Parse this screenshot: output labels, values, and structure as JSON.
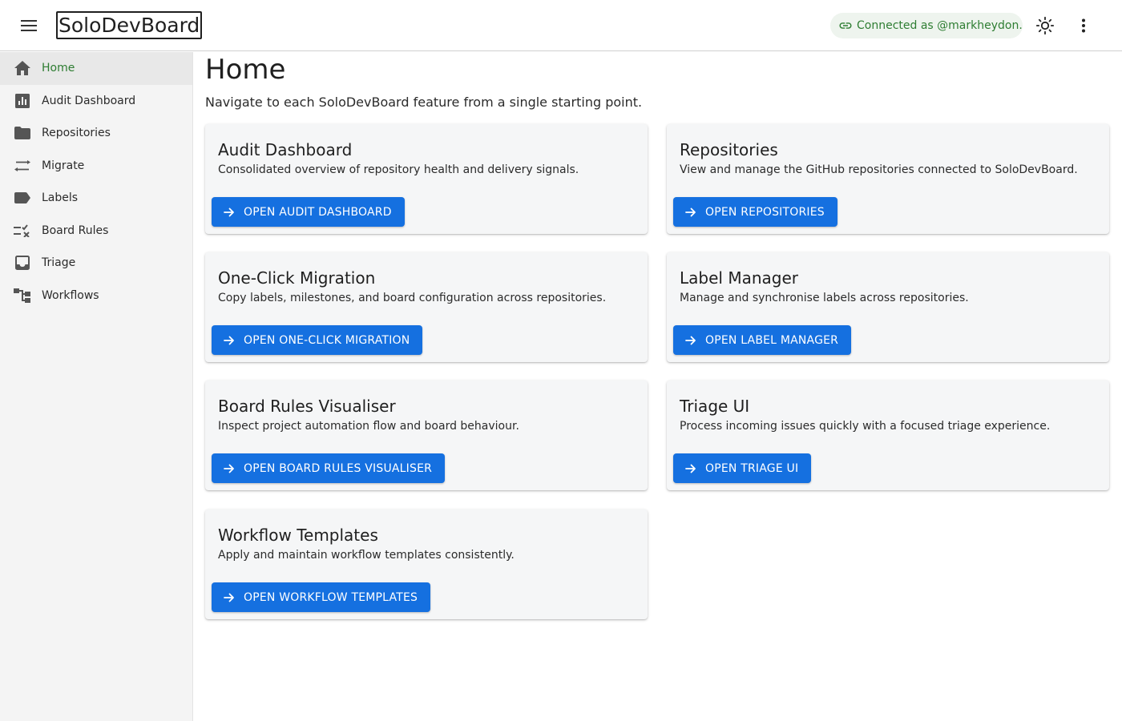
{
  "app": {
    "title": "SoloDevBoard",
    "connection": "Connected as @markheydon."
  },
  "sidebar": {
    "items": [
      {
        "label": "Home",
        "icon": "home-icon"
      },
      {
        "label": "Audit Dashboard",
        "icon": "chart-icon"
      },
      {
        "label": "Repositories",
        "icon": "folder-icon"
      },
      {
        "label": "Migrate",
        "icon": "swap-icon"
      },
      {
        "label": "Labels",
        "icon": "label-icon"
      },
      {
        "label": "Board Rules",
        "icon": "rule-icon"
      },
      {
        "label": "Triage",
        "icon": "inbox-icon"
      },
      {
        "label": "Workflows",
        "icon": "workflow-icon"
      }
    ],
    "active": "Home"
  },
  "main": {
    "title": "Home",
    "subtitle": "Navigate to each SoloDevBoard feature from a single starting point.",
    "cards": [
      {
        "title": "Audit Dashboard",
        "description": "Consolidated overview of repository health and delivery signals.",
        "button": "OPEN AUDIT DASHBOARD"
      },
      {
        "title": "Repositories",
        "description": "View and manage the GitHub repositories connected to SoloDevBoard.",
        "button": "OPEN REPOSITORIES"
      },
      {
        "title": "One-Click Migration",
        "description": "Copy labels, milestones, and board configuration across repositories.",
        "button": "OPEN ONE-CLICK MIGRATION"
      },
      {
        "title": "Label Manager",
        "description": "Manage and synchronise labels across repositories.",
        "button": "OPEN LABEL MANAGER"
      },
      {
        "title": "Board Rules Visualiser",
        "description": "Inspect project automation flow and board behaviour.",
        "button": "OPEN BOARD RULES VISUALISER"
      },
      {
        "title": "Triage UI",
        "description": "Process incoming issues quickly with a focused triage experience.",
        "button": "OPEN TRIAGE UI"
      },
      {
        "title": "Workflow Templates",
        "description": "Apply and maintain workflow templates consistently.",
        "button": "OPEN WORKFLOW TEMPLATES"
      }
    ]
  },
  "colors": {
    "accent": "#1570e0",
    "active_nav": "#2e7d32",
    "chip_bg": "#eef4ee"
  }
}
